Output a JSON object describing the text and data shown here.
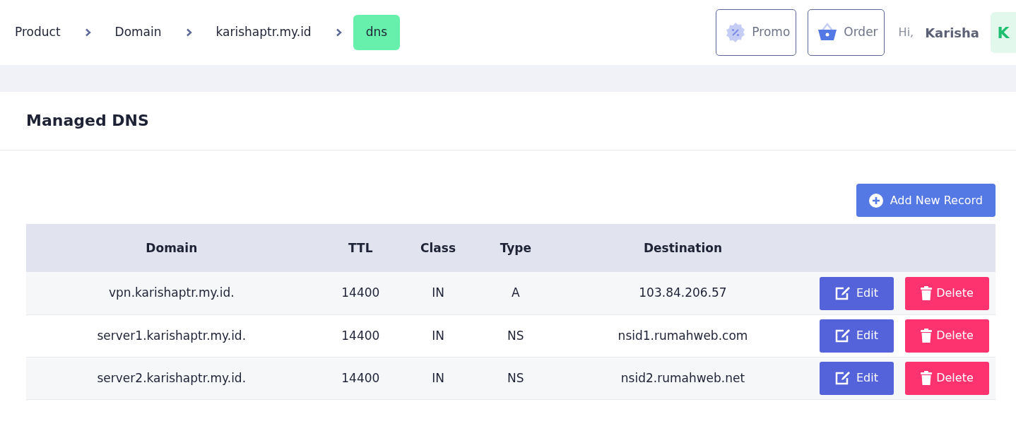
{
  "breadcrumb": [
    {
      "label": "Product",
      "selected": false
    },
    {
      "label": "Domain",
      "selected": false
    },
    {
      "label": "karishaptr.my.id",
      "selected": false
    },
    {
      "label": "dns",
      "selected": true
    }
  ],
  "header_buttons": [
    {
      "label": "Promo",
      "kind": "promo"
    },
    {
      "label": "Order",
      "kind": "order"
    }
  ],
  "user": {
    "greeting": "Hi,",
    "name": "Karisha",
    "avatar": "K"
  },
  "card": {
    "title": "Managed DNS",
    "add_button": "Add New Record"
  },
  "table": {
    "columns": [
      "Domain",
      "TTL",
      "Class",
      "Type",
      "Destination"
    ],
    "rows": [
      {
        "cells": [
          "vpn.karishaptr.my.id.",
          "14400",
          "IN",
          "A",
          "103.84.206.57"
        ],
        "actions": [
          "Edit",
          "Delete"
        ]
      },
      {
        "cells": [
          "server1.karishaptr.my.id.",
          "14400",
          "IN",
          "NS",
          "nsid1.rumahweb.com"
        ],
        "actions": [
          "Edit",
          "Delete"
        ]
      },
      {
        "cells": [
          "server2.karishaptr.my.id.",
          "14400",
          "IN",
          "NS",
          "nsid2.rumahweb.net"
        ],
        "actions": [
          "Edit",
          "Delete"
        ]
      }
    ]
  }
}
